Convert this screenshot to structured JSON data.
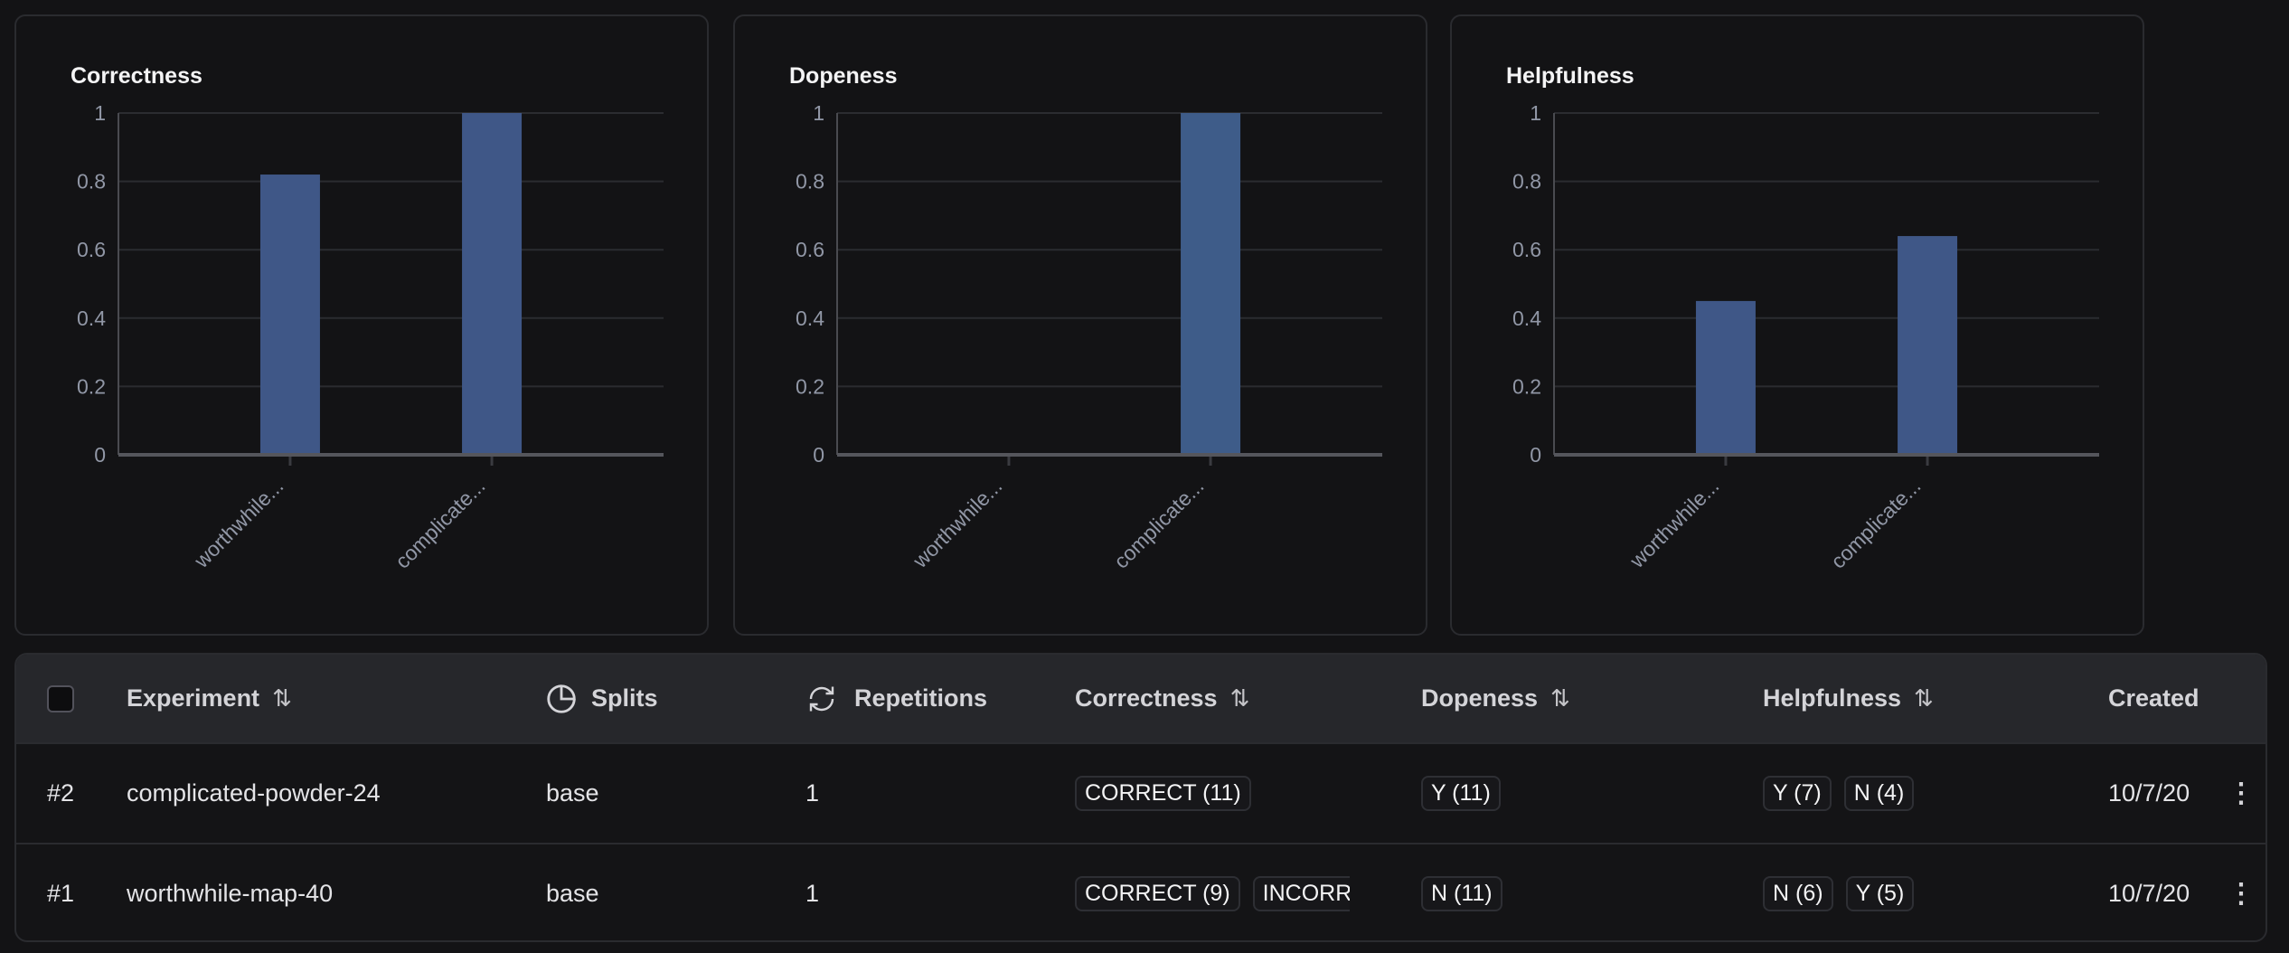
{
  "chart_data": [
    {
      "type": "bar",
      "title": "Correctness",
      "categories": [
        "worthwhile...",
        "complicate..."
      ],
      "values": [
        0.82,
        1
      ],
      "ylim": [
        0,
        1
      ],
      "yticks": [
        "0",
        "0.2",
        "0.4",
        "0.6",
        "0.8",
        "1"
      ],
      "grid": true,
      "color": "#3f5787"
    },
    {
      "type": "bar",
      "title": "Dopeness",
      "categories": [
        "worthwhile...",
        "complicate..."
      ],
      "values": [
        0,
        1
      ],
      "ylim": [
        0,
        1
      ],
      "yticks": [
        "0",
        "0.2",
        "0.4",
        "0.6",
        "0.8",
        "1"
      ],
      "grid": true,
      "color": "#3e5c89"
    },
    {
      "type": "bar",
      "title": "Helpfulness",
      "categories": [
        "worthwhile...",
        "complicate..."
      ],
      "values": [
        0.45,
        0.64
      ],
      "ylim": [
        0,
        1
      ],
      "yticks": [
        "0",
        "0.2",
        "0.4",
        "0.6",
        "0.8",
        "1"
      ],
      "grid": true,
      "color": "#3f5787"
    }
  ],
  "table": {
    "headers": {
      "experiment": "Experiment",
      "splits": "Splits",
      "repetitions": "Repetitions",
      "correctness": "Correctness",
      "dopeness": "Dopeness",
      "helpfulness": "Helpfulness",
      "created": "Created"
    },
    "rows": [
      {
        "id": "#2",
        "experiment": "complicated-powder-24",
        "splits": "base",
        "repetitions": "1",
        "correctness": [
          "CORRECT (11)"
        ],
        "dopeness": [
          "Y (11)"
        ],
        "helpfulness": [
          "Y (7)",
          "N (4)"
        ],
        "created": "10/7/20"
      },
      {
        "id": "#1",
        "experiment": "worthwhile-map-40",
        "splits": "base",
        "repetitions": "1",
        "correctness": [
          "CORRECT (9)",
          "INCORRECT"
        ],
        "dopeness": [
          "N (11)"
        ],
        "helpfulness": [
          "N (6)",
          "Y (5)"
        ],
        "created": "10/7/20"
      }
    ]
  }
}
